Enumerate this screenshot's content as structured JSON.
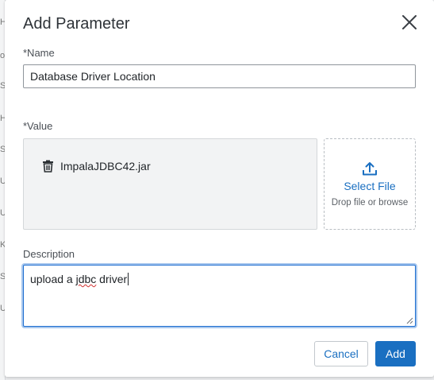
{
  "background_fragments": [
    "H",
    "o",
    "S",
    "H",
    "S",
    "U",
    "U",
    "K",
    "S",
    "U"
  ],
  "dialog": {
    "title": "Add Parameter",
    "close_icon": "close-icon",
    "name_field": {
      "label": "*Name",
      "value": "Database Driver Location"
    },
    "value_field": {
      "label": "*Value",
      "file": {
        "icon": "trash-icon",
        "name": "ImpalaJDBC42.jar"
      },
      "upload": {
        "icon": "upload-icon",
        "select_label": "Select File",
        "hint": "Drop file or browse"
      }
    },
    "description_field": {
      "label": "Description",
      "value_before": "upload a ",
      "value_misspelled": "jdbc",
      "value_after": " driver"
    },
    "buttons": {
      "cancel": "Cancel",
      "add": "Add"
    },
    "colors": {
      "accent": "#1a6fc1",
      "focus_ring": "#a9c8ee",
      "spellcheck": "#d12f2f"
    }
  }
}
